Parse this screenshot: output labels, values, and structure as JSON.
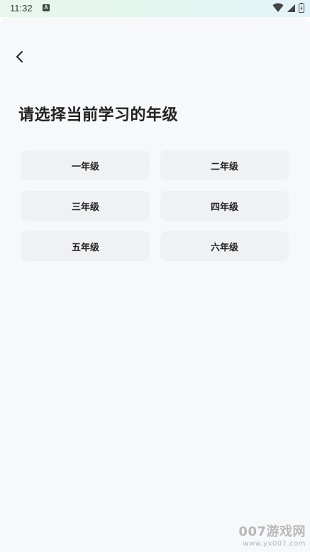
{
  "status_bar": {
    "time": "11:32",
    "notification_icon": "a-badge-icon",
    "wifi_icon": "wifi-icon",
    "signal_icon": "signal-icon",
    "battery_icon": "battery-icon"
  },
  "header": {
    "back_icon": "chevron-left-icon"
  },
  "main": {
    "title": "请选择当前学习的年级",
    "grades": [
      {
        "label": "一年级"
      },
      {
        "label": "二年级"
      },
      {
        "label": "三年级"
      },
      {
        "label": "四年级"
      },
      {
        "label": "五年级"
      },
      {
        "label": "六年级"
      }
    ]
  },
  "watermark": {
    "logo": "007游戏网",
    "url": "www.yx007.com"
  },
  "colors": {
    "background": "#f7f8fa",
    "button_background": "#f0f1f3",
    "text": "#222222"
  }
}
